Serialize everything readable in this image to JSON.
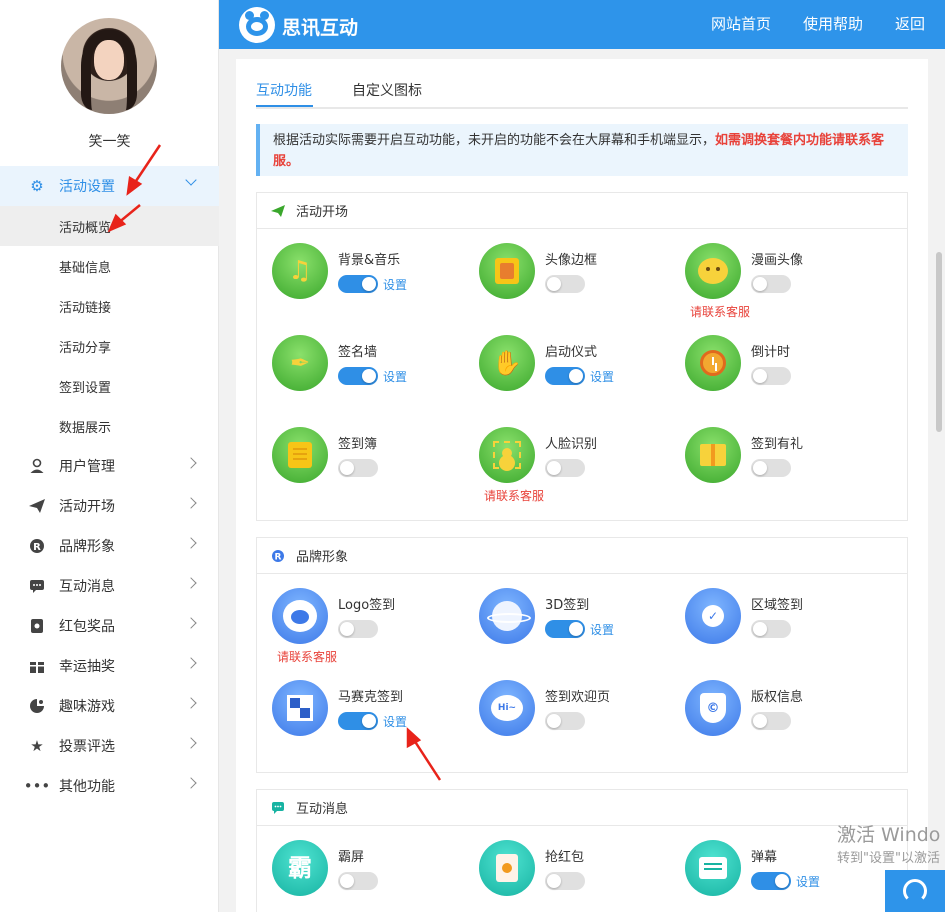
{
  "user": {
    "name": "笑一笑"
  },
  "sidebar": {
    "items": [
      {
        "label": "活动设置",
        "icon": "gears-icon",
        "open": true,
        "sub": [
          "活动概览",
          "基础信息",
          "活动链接",
          "活动分享",
          "签到设置",
          "数据展示"
        ]
      },
      {
        "label": "用户管理",
        "icon": "user-manage-icon"
      },
      {
        "label": "活动开场",
        "icon": "paper-plane-icon"
      },
      {
        "label": "品牌形象",
        "icon": "brand-r-icon"
      },
      {
        "label": "互动消息",
        "icon": "chat-icon"
      },
      {
        "label": "红包奖品",
        "icon": "red-packet-icon"
      },
      {
        "label": "幸运抽奖",
        "icon": "lottery-icon"
      },
      {
        "label": "趣味游戏",
        "icon": "game-icon"
      },
      {
        "label": "投票评选",
        "icon": "star-icon"
      },
      {
        "label": "其他功能",
        "icon": "more-icon"
      }
    ]
  },
  "header": {
    "brand": "思讯互动",
    "nav": [
      "网站首页",
      "使用帮助",
      "返回"
    ]
  },
  "tabs": [
    "互动功能",
    "自定义图标"
  ],
  "notice": {
    "text": "根据活动实际需要开启互动功能，未开启的功能不会在大屏幕和手机端显示，",
    "highlight": "如需调换套餐内功能请联系客服。"
  },
  "common": {
    "setting": "设置",
    "contact": "请联系客服"
  },
  "sections": [
    {
      "title": "活动开场",
      "icon": "paper-plane-icon",
      "features": [
        {
          "name": "背景&音乐",
          "on": true
        },
        {
          "name": "头像边框",
          "on": false
        },
        {
          "name": "漫画头像",
          "on": false,
          "contact": true
        },
        {
          "name": "签名墙",
          "on": true
        },
        {
          "name": "启动仪式",
          "on": true
        },
        {
          "name": "倒计时",
          "on": false
        },
        {
          "name": "签到簿",
          "on": false
        },
        {
          "name": "人脸识别",
          "on": false,
          "contact": true
        },
        {
          "name": "签到有礼",
          "on": false
        }
      ]
    },
    {
      "title": "品牌形象",
      "icon": "brand-r-icon",
      "features": [
        {
          "name": "Logo签到",
          "on": false,
          "contact": true
        },
        {
          "name": "3D签到",
          "on": true
        },
        {
          "name": "区域签到",
          "on": false
        },
        {
          "name": "马赛克签到",
          "on": true
        },
        {
          "name": "签到欢迎页",
          "on": false
        },
        {
          "name": "版权信息",
          "on": false
        }
      ]
    },
    {
      "title": "互动消息",
      "icon": "chat-icon",
      "features": [
        {
          "name": "霸屏",
          "on": false
        },
        {
          "name": "抢红包",
          "on": false
        },
        {
          "name": "弹幕",
          "on": true
        }
      ]
    }
  ],
  "glyphs": {
    "ba": "霸",
    "hi": "Hi~",
    "copyright": "©",
    "music": "♫",
    "hand": "✋",
    "quill": "✒",
    "check": "✓"
  },
  "watermark": {
    "line1": "激活 Windo",
    "line2": "转到\"设置\"以激活"
  },
  "colors": {
    "primary": "#2e94ea",
    "danger": "#e8423a",
    "green": "#3aa72c",
    "blue": "#3d79e8",
    "teal": "#17b3a2"
  }
}
